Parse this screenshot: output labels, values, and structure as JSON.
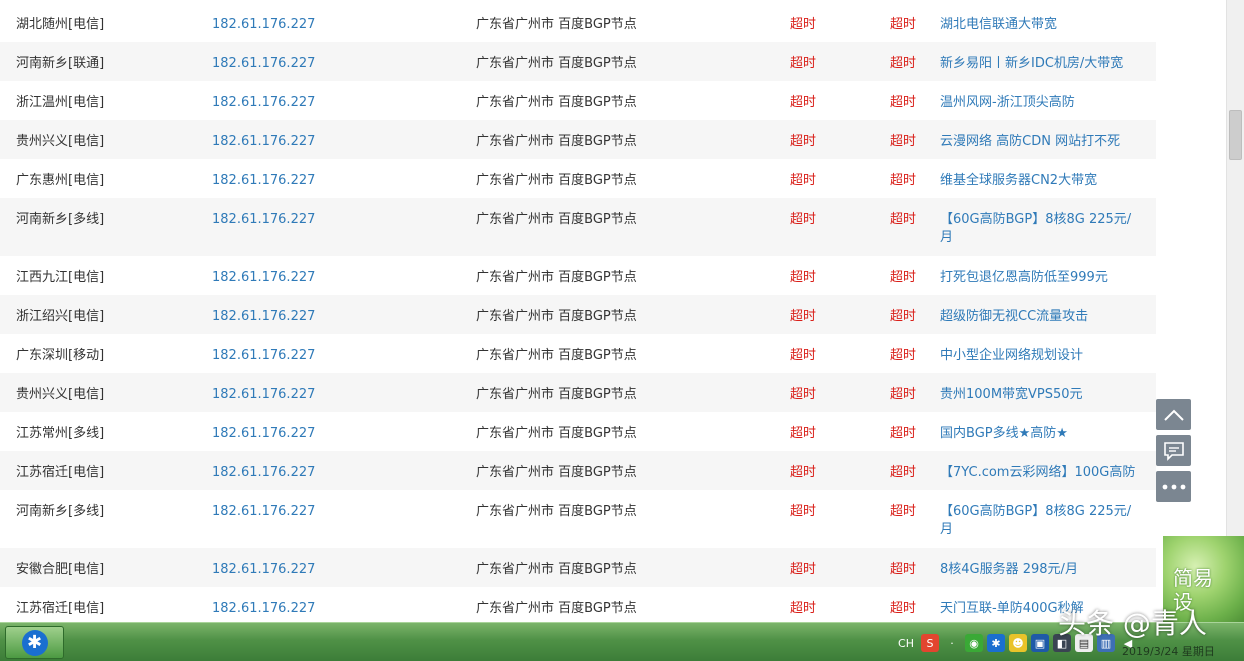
{
  "rows": [
    {
      "location": "湖北随州[电信]",
      "ip": "182.61.176.227",
      "isp": "广东省广州市 百度BGP节点",
      "t1": "超时",
      "t2": "超时",
      "ad": "湖北电信联通大带宽"
    },
    {
      "location": "河南新乡[联通]",
      "ip": "182.61.176.227",
      "isp": "广东省广州市 百度BGP节点",
      "t1": "超时",
      "t2": "超时",
      "ad": "新乡易阳丨新乡IDC机房/大带宽"
    },
    {
      "location": "浙江温州[电信]",
      "ip": "182.61.176.227",
      "isp": "广东省广州市 百度BGP节点",
      "t1": "超时",
      "t2": "超时",
      "ad": "温州风网-浙江顶尖高防"
    },
    {
      "location": "贵州兴义[电信]",
      "ip": "182.61.176.227",
      "isp": "广东省广州市 百度BGP节点",
      "t1": "超时",
      "t2": "超时",
      "ad": "云漫网络 高防CDN 网站打不死"
    },
    {
      "location": "广东惠州[电信]",
      "ip": "182.61.176.227",
      "isp": "广东省广州市 百度BGP节点",
      "t1": "超时",
      "t2": "超时",
      "ad": "维基全球服务器CN2大带宽"
    },
    {
      "location": "河南新乡[多线]",
      "ip": "182.61.176.227",
      "isp": "广东省广州市 百度BGP节点",
      "t1": "超时",
      "t2": "超时",
      "ad": "【60G高防BGP】8核8G 225元/月"
    },
    {
      "location": "江西九江[电信]",
      "ip": "182.61.176.227",
      "isp": "广东省广州市 百度BGP节点",
      "t1": "超时",
      "t2": "超时",
      "ad": "打死包退亿恩高防低至999元"
    },
    {
      "location": "浙江绍兴[电信]",
      "ip": "182.61.176.227",
      "isp": "广东省广州市 百度BGP节点",
      "t1": "超时",
      "t2": "超时",
      "ad": "超级防御无视CC流量攻击"
    },
    {
      "location": "广东深圳[移动]",
      "ip": "182.61.176.227",
      "isp": "广东省广州市 百度BGP节点",
      "t1": "超时",
      "t2": "超时",
      "ad": "中小型企业网络规划设计"
    },
    {
      "location": "贵州兴义[电信]",
      "ip": "182.61.176.227",
      "isp": "广东省广州市 百度BGP节点",
      "t1": "超时",
      "t2": "超时",
      "ad": "贵州100M带宽VPS50元"
    },
    {
      "location": "江苏常州[多线]",
      "ip": "182.61.176.227",
      "isp": "广东省广州市 百度BGP节点",
      "t1": "超时",
      "t2": "超时",
      "ad": "国内BGP多线★高防★"
    },
    {
      "location": "江苏宿迁[电信]",
      "ip": "182.61.176.227",
      "isp": "广东省广州市 百度BGP节点",
      "t1": "超时",
      "t2": "超时",
      "ad": "【7YC.com云彩网络】100G高防"
    },
    {
      "location": "河南新乡[多线]",
      "ip": "182.61.176.227",
      "isp": "广东省广州市 百度BGP节点",
      "t1": "超时",
      "t2": "超时",
      "ad": "【60G高防BGP】8核8G 225元/月"
    },
    {
      "location": "安徽合肥[电信]",
      "ip": "182.61.176.227",
      "isp": "广东省广州市 百度BGP节点",
      "t1": "超时",
      "t2": "超时",
      "ad": "8核4G服务器 298元/月"
    },
    {
      "location": "江苏宿迁[电信]",
      "ip": "182.61.176.227",
      "isp": "广东省广州市 百度BGP节点",
      "t1": "超时",
      "t2": "超时",
      "ad": "天门互联-单防400G秒解"
    }
  ],
  "side_buttons": {
    "top_icon": "chevron-up-icon",
    "comment_icon": "comment-icon",
    "more_icon": "more-icon"
  },
  "promo": {
    "text": "简易设"
  },
  "taskbar": {
    "ime": "CH",
    "date": "2019/3/24 星期日"
  },
  "watermark": "头条 @青人",
  "colors": {
    "link": "#2f7ab8",
    "timeout": "#d9201a",
    "stripe": "#f6f6f6",
    "side_button": "#7b8691"
  }
}
